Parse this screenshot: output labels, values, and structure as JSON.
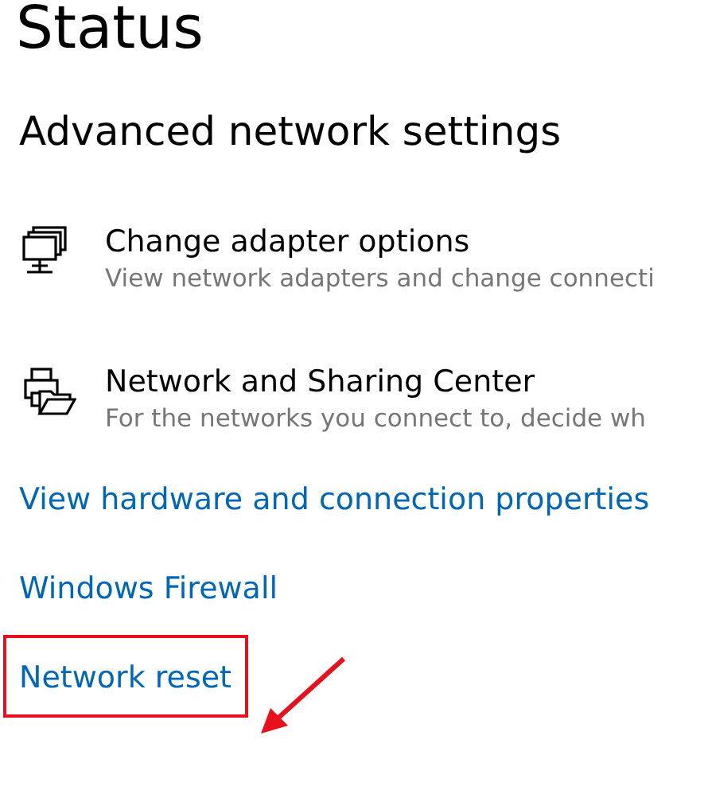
{
  "page": {
    "title": "Status"
  },
  "section": {
    "heading": "Advanced network settings"
  },
  "items": [
    {
      "kind": "adapter",
      "title": "Change adapter options",
      "description": "View network adapters and change connecti"
    },
    {
      "kind": "sharing",
      "title": "Network and Sharing Center",
      "description": "For the networks you connect to, decide wh"
    }
  ],
  "links": [
    {
      "label": "View hardware and connection properties",
      "highlighted": false
    },
    {
      "label": "Windows Firewall",
      "highlighted": false
    },
    {
      "label": "Network reset",
      "highlighted": true
    }
  ]
}
